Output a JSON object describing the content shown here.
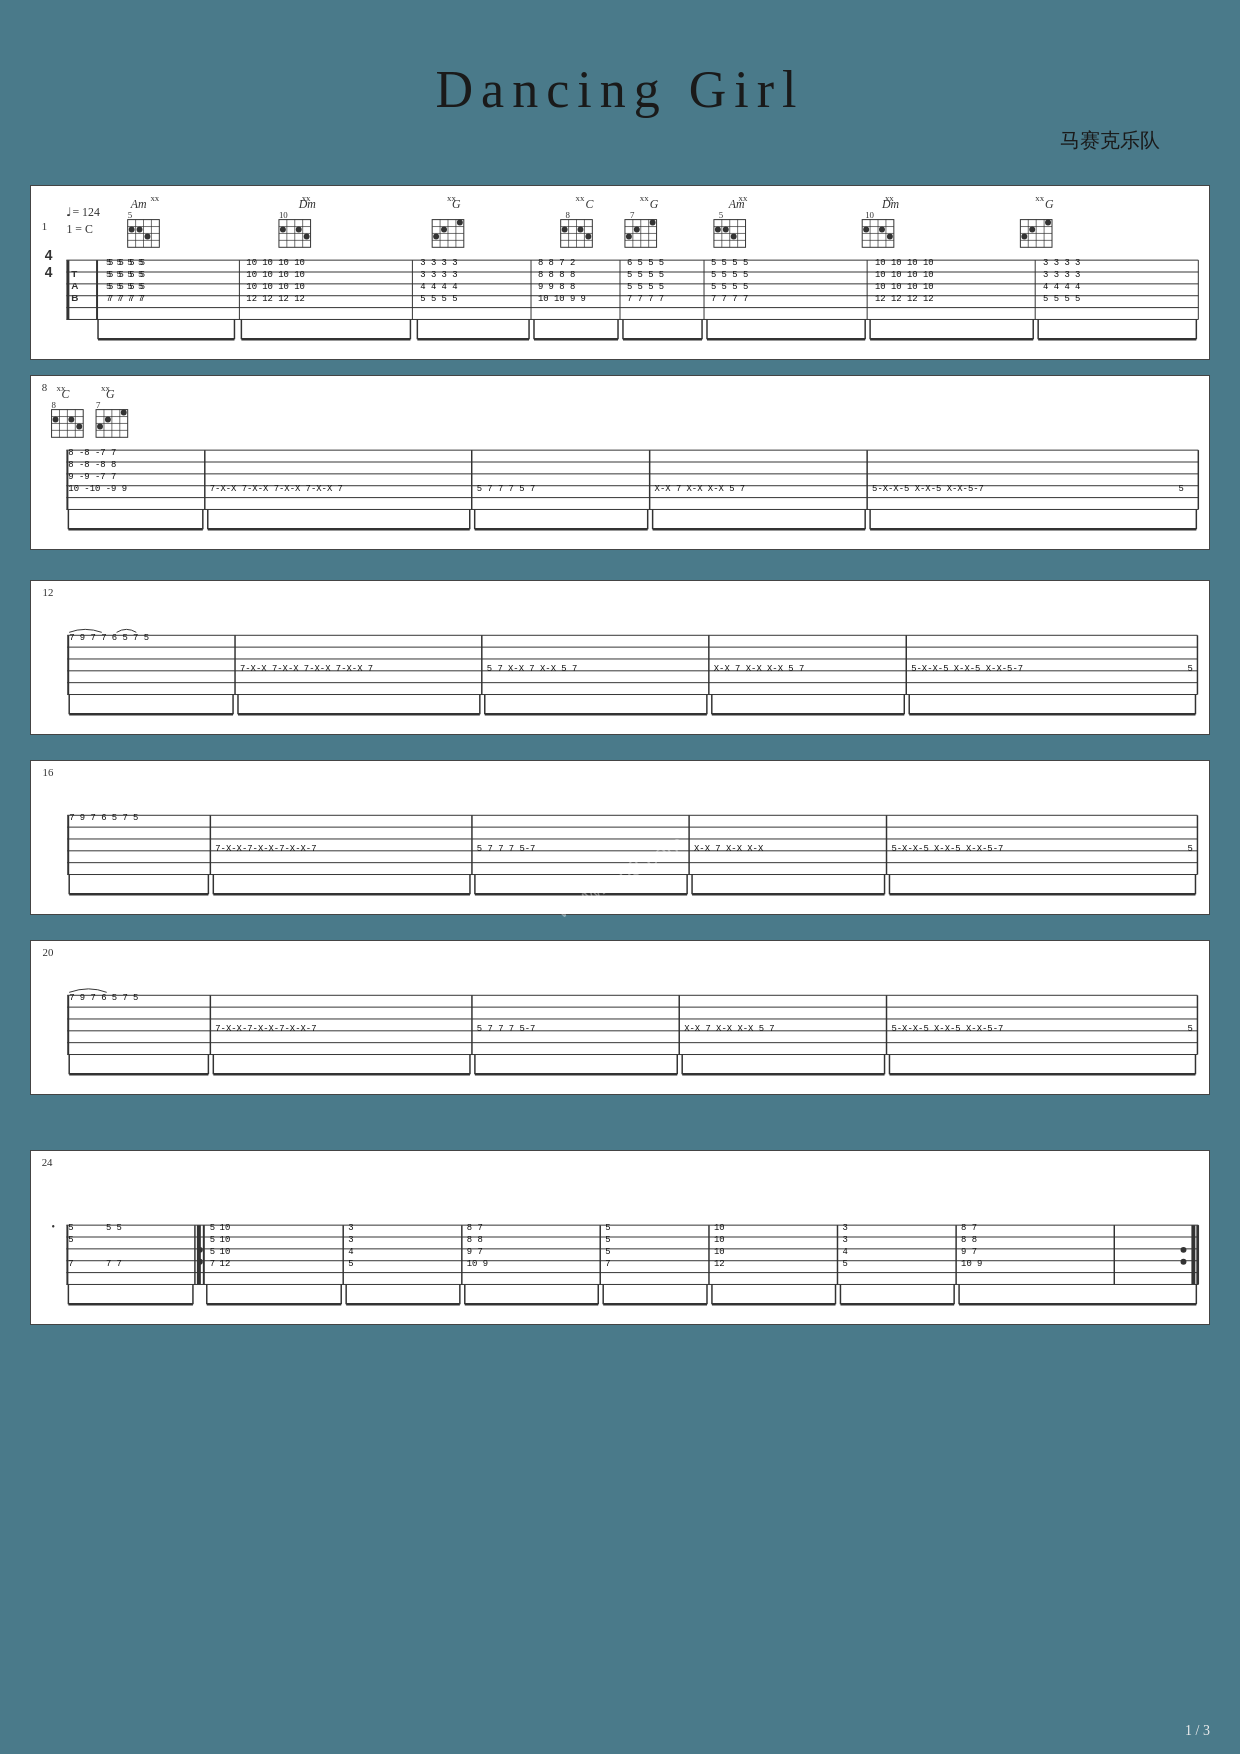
{
  "title": "Dancing  Girl",
  "band": "马赛克乐队",
  "tempo": "♩= 124",
  "key": "1 = C",
  "page_number": "1 / 3",
  "watermark": "www.tan8.com",
  "sections": [
    {
      "id": 1,
      "measure_start": 1
    },
    {
      "id": 2,
      "measure_start": 8
    },
    {
      "id": 3,
      "measure_start": 12
    },
    {
      "id": 4,
      "measure_start": 16
    },
    {
      "id": 5,
      "measure_start": 20
    },
    {
      "id": 6,
      "measure_start": 24
    }
  ]
}
